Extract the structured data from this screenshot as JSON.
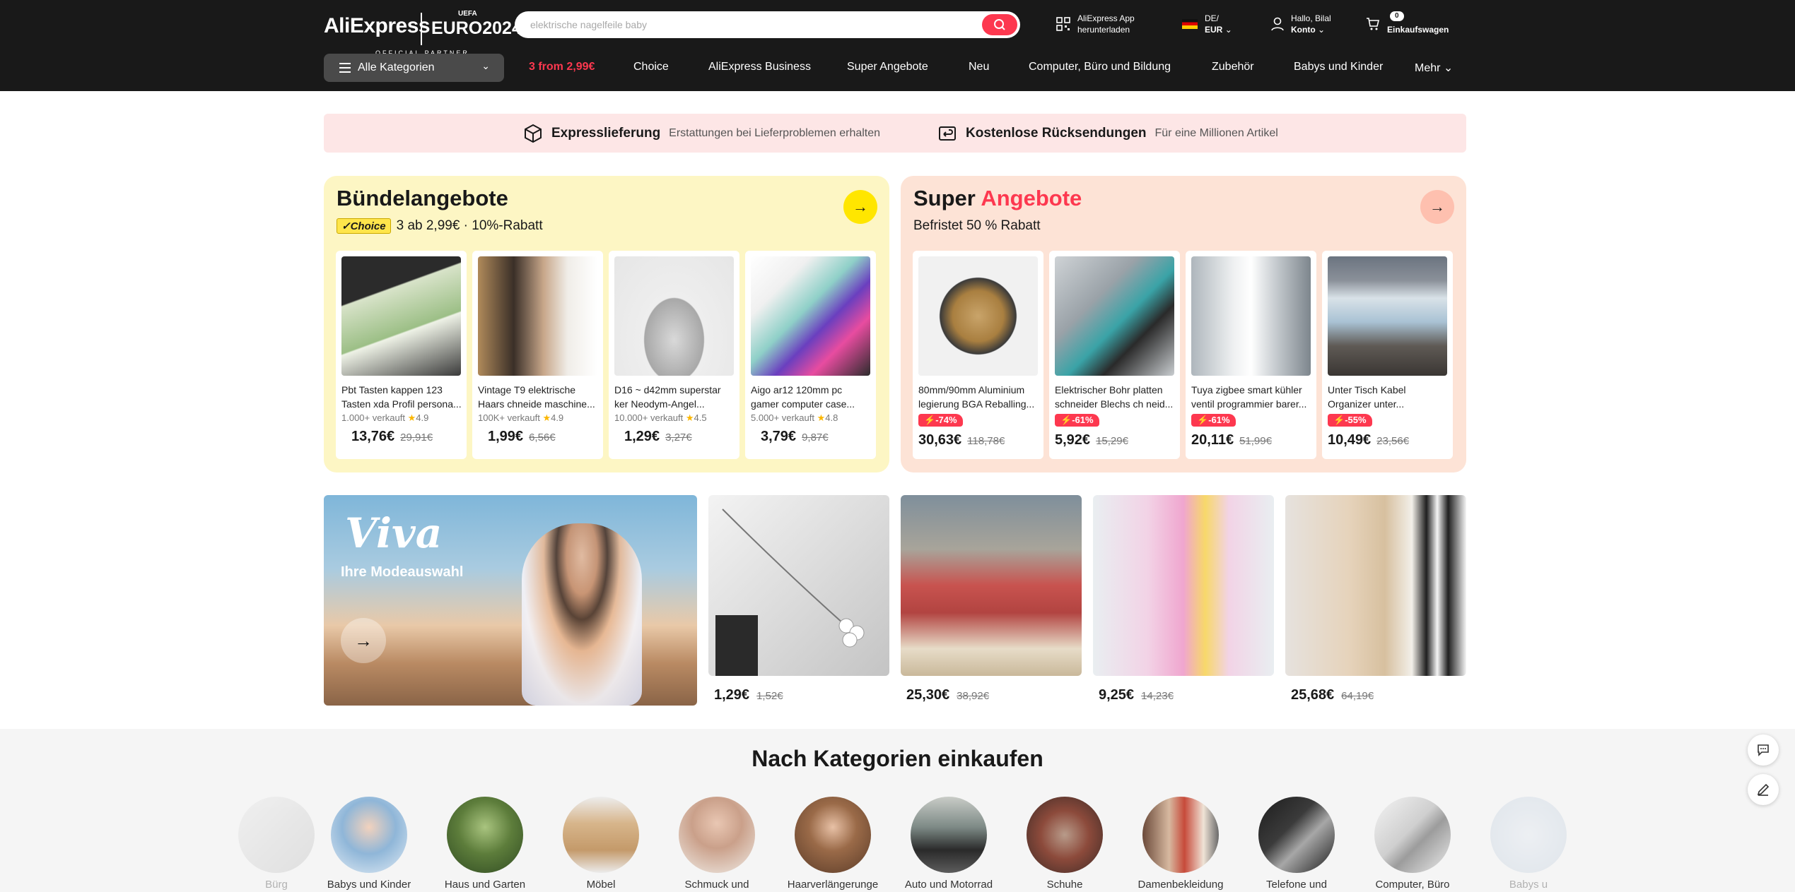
{
  "header": {
    "logo_text": "AliExpress",
    "euro_text": "EURO2024",
    "uefa_text": "UEFA",
    "partner_text": "OFFICIAL PARTNER",
    "search_placeholder": "elektrische nagelfeile baby",
    "app_line1": "AliExpress App",
    "app_line2": "herunterladen",
    "locale_line1": "DE/",
    "locale_line2": "EUR",
    "account_line1": "Hallo, Bilal",
    "account_line2": "Konto",
    "cart_count": "0",
    "cart_label": "Einkaufswagen"
  },
  "nav": {
    "all_categories": "Alle Kategorien",
    "links": [
      "3 from 2,99€",
      "Choice",
      "AliExpress Business",
      "Super Angebote",
      "Neu",
      "Computer, Büro und Bildung",
      "Zubehör",
      "Babys und Kinder",
      "Mehr"
    ]
  },
  "strip": {
    "item1_title": "Expresslieferung",
    "item1_sub": "Erstattungen bei Lieferproblemen erhalten",
    "item2_title": "Kostenlose Rücksendungen",
    "item2_sub": "Für eine Millionen Artikel"
  },
  "bundle": {
    "title": "Bündelangebote",
    "choice_badge": "Choice",
    "subtitle": "3 ab 2,99€ · 10%-Rabatt",
    "products": [
      {
        "name": "Pbt Tasten kappen 123 Tasten xda Profil persona...",
        "sold": "1.000+ verkauft",
        "rating": "4.9",
        "price": "13,76€",
        "old": "29,91€"
      },
      {
        "name": "Vintage T9 elektrische Haars chneide maschine...",
        "sold": "100K+ verkauft",
        "rating": "4.9",
        "price": "1,99€",
        "old": "6,56€"
      },
      {
        "name": "D16 ~ d42mm superstar ker Neodym-Angel...",
        "sold": "10.000+ verkauft",
        "rating": "4.5",
        "price": "1,29€",
        "old": "3,27€"
      },
      {
        "name": "Aigo ar12 120mm pc gamer computer case...",
        "sold": "5.000+ verkauft",
        "rating": "4.8",
        "price": "3,79€",
        "old": "9,87€"
      }
    ]
  },
  "super": {
    "title_a": "Super",
    "title_b": "Angebote",
    "subtitle": "Befristet 50 % Rabatt",
    "products": [
      {
        "name": "80mm/90mm Aluminium legierung BGA Reballing...",
        "discount": "-74%",
        "price": "30,63€",
        "old": "118,78€"
      },
      {
        "name": "Elektrischer Bohr platten schneider Blechs ch neid...",
        "discount": "-61%",
        "price": "5,92€",
        "old": "15,29€"
      },
      {
        "name": "Tuya zigbee smart kühler ventil programmier barer...",
        "discount": "-61%",
        "price": "20,11€",
        "old": "51,99€"
      },
      {
        "name": "Unter Tisch Kabel Organizer unter...",
        "discount": "-55%",
        "price": "10,49€",
        "old": "23,56€"
      }
    ]
  },
  "fashion": {
    "banner_brand": "Viva",
    "banner_sub": "Ihre Modeauswahl",
    "items": [
      {
        "price": "1,29€",
        "old": "1,52€"
      },
      {
        "price": "25,30€",
        "old": "38,92€"
      },
      {
        "price": "9,25€",
        "old": "14,23€"
      },
      {
        "price": "25,68€",
        "old": "64,19€"
      }
    ]
  },
  "categories": {
    "title": "Nach Kategorien einkaufen",
    "items": [
      "Bürg",
      "Babys und Kinder",
      "Haus und Garten",
      "Möbel",
      "Schmuck und",
      "Haarverlängerunge",
      "Auto und Motorrad",
      "Schuhe",
      "Damenbekleidung",
      "Telefone und",
      "Computer, Büro",
      "Babys u"
    ]
  },
  "colors": {
    "brand_red": "#fd384f",
    "header_bg": "#191919",
    "bundle_bg": "#fdf6c4",
    "super_bg": "#fde3d6"
  }
}
